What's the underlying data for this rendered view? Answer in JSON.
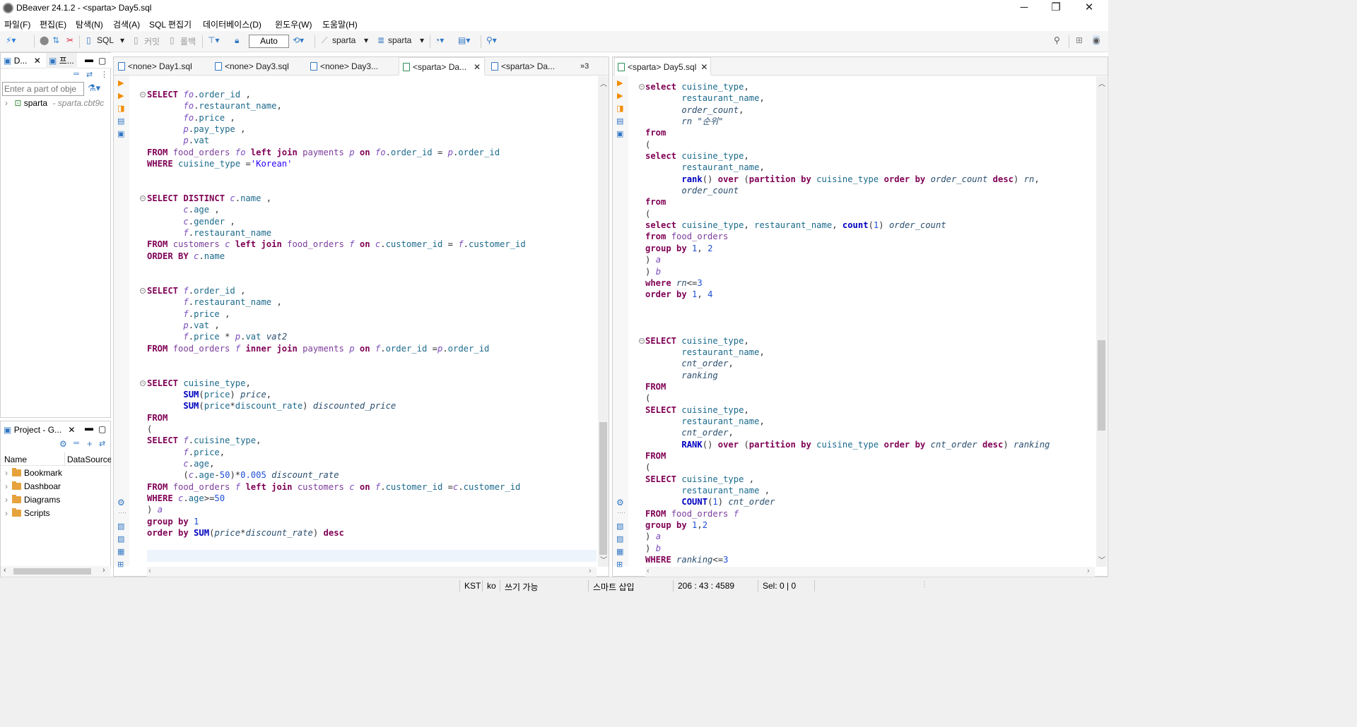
{
  "window": {
    "title": "DBeaver 24.1.2 - <sparta> Day5.sql",
    "controls": {
      "minimize": "─",
      "maximize": "❐",
      "close": "✕"
    }
  },
  "menu": [
    "파일(F)",
    "편집(E)",
    "탐색(N)",
    "검색(A)",
    "SQL 편집기",
    "데이터베이스(D)",
    "윈도우(W)",
    "도움말(H)"
  ],
  "toolbar": {
    "sql_label": "SQL",
    "commit_label": "커밋",
    "rollback_label": "롤백",
    "transaction_mode": "Auto",
    "datasource": "sparta",
    "schema": "sparta"
  },
  "navigator": {
    "tab1": "D...",
    "tab2": "프...",
    "filter_placeholder": "Enter a part of obje",
    "tree": [
      {
        "label": "sparta",
        "detail": "- sparta.cbt9c"
      }
    ]
  },
  "project": {
    "tab": "Project - G...",
    "col_name": "Name",
    "col_datasource": "DataSource",
    "items": [
      "Bookmark",
      "Dashboar",
      "Diagrams",
      "Scripts"
    ]
  },
  "editor_left": {
    "tabs": [
      "<none> Day1.sql",
      "<none> Day3.sql",
      "<none> Day3...",
      "<sparta> Da...",
      "<sparta> Da..."
    ],
    "overflow": "»3"
  },
  "editor_right": {
    "tab": "<sparta> Day5.sql"
  },
  "status": {
    "timezone": "KST",
    "locale": "ko",
    "writable": "쓰기 가능",
    "insert_mode": "스마트 삽입",
    "position": "206 : 43 : 4589",
    "selection": "Sel: 0 | 0"
  },
  "colors": {
    "keyword": "#7f0055",
    "function": "#0000c0",
    "alias": "#7c4dbe",
    "table": "#7c3c9c",
    "column": "#1c6a8c",
    "string": "#2a00ff",
    "number": "#1d4fd6",
    "accent": "#3277c4"
  },
  "icons": [
    "dbeaver-app-icon",
    "new-connection-icon",
    "connect-icon",
    "disconnect-icon",
    "sql-editor-icon",
    "commit-icon",
    "rollback-icon",
    "transaction-icon",
    "lock-icon",
    "history-icon",
    "datasource-icon",
    "schema-icon",
    "search-icon",
    "filter-icon",
    "run-icon",
    "script-icon",
    "settings-icon"
  ],
  "code_left": [
    [
      [
        "kw",
        "SELECT "
      ],
      [
        "al",
        "fo"
      ],
      [
        "",
        "."
      ],
      [
        "col",
        "order_id"
      ],
      [
        "",
        " ,"
      ]
    ],
    [
      [
        "",
        "       "
      ],
      [
        "al",
        "fo"
      ],
      [
        "",
        "."
      ],
      [
        "col",
        "restaurant_name"
      ],
      [
        "",
        ","
      ]
    ],
    [
      [
        "",
        "       "
      ],
      [
        "al",
        "fo"
      ],
      [
        "",
        "."
      ],
      [
        "col",
        "price"
      ],
      [
        "",
        " ,"
      ]
    ],
    [
      [
        "",
        "       "
      ],
      [
        "al",
        "p"
      ],
      [
        "",
        "."
      ],
      [
        "col",
        "pay_type"
      ],
      [
        "",
        " ,"
      ]
    ],
    [
      [
        "",
        "       "
      ],
      [
        "al",
        "p"
      ],
      [
        "",
        "."
      ],
      [
        "col",
        "vat"
      ]
    ],
    [
      [
        "kw",
        "FROM "
      ],
      [
        "tbl",
        "food_orders "
      ],
      [
        "al",
        "fo "
      ],
      [
        "kw",
        "left join "
      ],
      [
        "tbl",
        "payments "
      ],
      [
        "al",
        "p "
      ],
      [
        "kw",
        "on "
      ],
      [
        "al",
        "fo"
      ],
      [
        "",
        "."
      ],
      [
        "col",
        "order_id"
      ],
      [
        "",
        " = "
      ],
      [
        "al",
        "p"
      ],
      [
        "",
        "."
      ],
      [
        "col",
        "order_id"
      ]
    ],
    [
      [
        "kw",
        "WHERE "
      ],
      [
        "col",
        "cuisine_type "
      ],
      [
        "",
        "="
      ],
      [
        "str",
        "'Korean'"
      ]
    ],
    [],
    [],
    [
      [
        "kw",
        "SELECT DISTINCT "
      ],
      [
        "al",
        "c"
      ],
      [
        "",
        "."
      ],
      [
        "col",
        "name"
      ],
      [
        "",
        " ,"
      ]
    ],
    [
      [
        "",
        "       "
      ],
      [
        "al",
        "c"
      ],
      [
        "",
        "."
      ],
      [
        "col",
        "age"
      ],
      [
        "",
        " ,"
      ]
    ],
    [
      [
        "",
        "       "
      ],
      [
        "al",
        "c"
      ],
      [
        "",
        "."
      ],
      [
        "col",
        "gender"
      ],
      [
        "",
        " ,"
      ]
    ],
    [
      [
        "",
        "       "
      ],
      [
        "al",
        "f"
      ],
      [
        "",
        "."
      ],
      [
        "col",
        "restaurant_name"
      ]
    ],
    [
      [
        "kw",
        "FROM "
      ],
      [
        "tbl",
        "customers "
      ],
      [
        "al",
        "c "
      ],
      [
        "kw",
        "left join "
      ],
      [
        "tbl",
        "food_orders "
      ],
      [
        "al",
        "f "
      ],
      [
        "kw",
        "on "
      ],
      [
        "al",
        "c"
      ],
      [
        "",
        "."
      ],
      [
        "col",
        "customer_id"
      ],
      [
        "",
        " = "
      ],
      [
        "al",
        "f"
      ],
      [
        "",
        "."
      ],
      [
        "col",
        "customer_id"
      ]
    ],
    [
      [
        "kw",
        "ORDER BY "
      ],
      [
        "al",
        "c"
      ],
      [
        "",
        "."
      ],
      [
        "col",
        "name"
      ]
    ],
    [],
    [],
    [
      [
        "kw",
        "SELECT "
      ],
      [
        "al",
        "f"
      ],
      [
        "",
        "."
      ],
      [
        "col",
        "order_id"
      ],
      [
        "",
        " ,"
      ]
    ],
    [
      [
        "",
        "       "
      ],
      [
        "al",
        "f"
      ],
      [
        "",
        "."
      ],
      [
        "col",
        "restaurant_name"
      ],
      [
        "",
        " ,"
      ]
    ],
    [
      [
        "",
        "       "
      ],
      [
        "al",
        "f"
      ],
      [
        "",
        "."
      ],
      [
        "col",
        "price"
      ],
      [
        "",
        " ,"
      ]
    ],
    [
      [
        "",
        "       "
      ],
      [
        "al",
        "p"
      ],
      [
        "",
        "."
      ],
      [
        "col",
        "vat"
      ],
      [
        "",
        " ,"
      ]
    ],
    [
      [
        "",
        "       "
      ],
      [
        "al",
        "f"
      ],
      [
        "",
        "."
      ],
      [
        "col",
        "price"
      ],
      [
        "",
        " * "
      ],
      [
        "al",
        "p"
      ],
      [
        "",
        "."
      ],
      [
        "col",
        "vat "
      ],
      [
        "ita",
        "vat2"
      ]
    ],
    [
      [
        "kw",
        "FROM "
      ],
      [
        "tbl",
        "food_orders "
      ],
      [
        "al",
        "f "
      ],
      [
        "kw",
        "inner join "
      ],
      [
        "tbl",
        "payments "
      ],
      [
        "al",
        "p "
      ],
      [
        "kw",
        "on "
      ],
      [
        "al",
        "f"
      ],
      [
        "",
        "."
      ],
      [
        "col",
        "order_id"
      ],
      [
        "",
        " ="
      ],
      [
        "al",
        "p"
      ],
      [
        "",
        "."
      ],
      [
        "col",
        "order_id"
      ]
    ],
    [],
    [],
    [
      [
        "kw",
        "SELECT "
      ],
      [
        "col",
        "cuisine_type"
      ],
      [
        "",
        ","
      ]
    ],
    [
      [
        "",
        "       "
      ],
      [
        "kw2",
        "SUM"
      ],
      [
        "",
        "("
      ],
      [
        "col",
        "price"
      ],
      [
        "",
        ") "
      ],
      [
        "ita",
        "price"
      ],
      [
        "",
        ","
      ]
    ],
    [
      [
        "",
        "       "
      ],
      [
        "kw2",
        "SUM"
      ],
      [
        "",
        "("
      ],
      [
        "col",
        "price"
      ],
      [
        "",
        "*"
      ],
      [
        "col",
        "discount_rate"
      ],
      [
        "",
        ") "
      ],
      [
        "ita",
        "discounted_price"
      ]
    ],
    [
      [
        "kw",
        "FROM"
      ]
    ],
    [
      [
        "",
        "("
      ]
    ],
    [
      [
        "kw",
        "SELECT "
      ],
      [
        "al",
        "f"
      ],
      [
        "",
        "."
      ],
      [
        "col",
        "cuisine_type"
      ],
      [
        "",
        ","
      ]
    ],
    [
      [
        "",
        "       "
      ],
      [
        "al",
        "f"
      ],
      [
        "",
        "."
      ],
      [
        "col",
        "price"
      ],
      [
        "",
        ","
      ]
    ],
    [
      [
        "",
        "       "
      ],
      [
        "al",
        "c"
      ],
      [
        "",
        "."
      ],
      [
        "col",
        "age"
      ],
      [
        "",
        ","
      ]
    ],
    [
      [
        "",
        "       ("
      ],
      [
        "al",
        "c"
      ],
      [
        "",
        "."
      ],
      [
        "col",
        "age"
      ],
      [
        "",
        "-"
      ],
      [
        "num",
        "50"
      ],
      [
        "",
        ")*"
      ],
      [
        "num",
        "0.005 "
      ],
      [
        "ita",
        "discount_rate"
      ]
    ],
    [
      [
        "kw",
        "FROM "
      ],
      [
        "tbl",
        "food_orders "
      ],
      [
        "al",
        "f "
      ],
      [
        "kw",
        "left join "
      ],
      [
        "tbl",
        "customers "
      ],
      [
        "al",
        "c "
      ],
      [
        "kw",
        "on "
      ],
      [
        "al",
        "f"
      ],
      [
        "",
        "."
      ],
      [
        "col",
        "customer_id"
      ],
      [
        "",
        " ="
      ],
      [
        "al",
        "c"
      ],
      [
        "",
        "."
      ],
      [
        "col",
        "customer_id"
      ]
    ],
    [
      [
        "kw",
        "WHERE "
      ],
      [
        "al",
        "c"
      ],
      [
        "",
        "."
      ],
      [
        "col",
        "age"
      ],
      [
        "",
        ">="
      ],
      [
        "num",
        "50"
      ]
    ],
    [
      [
        "",
        ") "
      ],
      [
        "al",
        "a"
      ]
    ],
    [
      [
        "kw",
        "group by "
      ],
      [
        "num",
        "1"
      ]
    ],
    [
      [
        "kw",
        "order by "
      ],
      [
        "kw2",
        "SUM"
      ],
      [
        "",
        "("
      ],
      [
        "ita",
        "price"
      ],
      [
        "",
        "*"
      ],
      [
        "ita",
        "discount_rate"
      ],
      [
        "",
        ") "
      ],
      [
        "kw",
        "desc"
      ]
    ]
  ],
  "code_right": [
    [
      [
        "kw",
        "select "
      ],
      [
        "col",
        "cuisine_type"
      ],
      [
        "",
        ","
      ]
    ],
    [
      [
        "",
        "       "
      ],
      [
        "col",
        "restaurant_name"
      ],
      [
        "",
        ","
      ]
    ],
    [
      [
        "",
        "       "
      ],
      [
        "ita",
        "order_count"
      ],
      [
        "",
        ","
      ]
    ],
    [
      [
        "",
        "       "
      ],
      [
        "ita",
        "rn "
      ],
      [
        "ita",
        "\"순위\""
      ]
    ],
    [
      [
        "kw",
        "from"
      ]
    ],
    [
      [
        "",
        "("
      ]
    ],
    [
      [
        "kw",
        "select "
      ],
      [
        "col",
        "cuisine_type"
      ],
      [
        "",
        ","
      ]
    ],
    [
      [
        "",
        "       "
      ],
      [
        "col",
        "restaurant_name"
      ],
      [
        "",
        ","
      ]
    ],
    [
      [
        "",
        "       "
      ],
      [
        "kw2",
        "rank"
      ],
      [
        "",
        "() "
      ],
      [
        "kw",
        "over "
      ],
      [
        "",
        "("
      ],
      [
        "kw",
        "partition by "
      ],
      [
        "col",
        "cuisine_type "
      ],
      [
        "kw",
        "order by "
      ],
      [
        "ita",
        "order_count "
      ],
      [
        "kw",
        "desc"
      ],
      [
        "",
        ") "
      ],
      [
        "ita",
        "rn"
      ],
      [
        "",
        ","
      ]
    ],
    [
      [
        "",
        "       "
      ],
      [
        "ita",
        "order_count"
      ]
    ],
    [
      [
        "kw",
        "from"
      ]
    ],
    [
      [
        "",
        "("
      ]
    ],
    [
      [
        "kw",
        "select "
      ],
      [
        "col",
        "cuisine_type"
      ],
      [
        "",
        ", "
      ],
      [
        "col",
        "restaurant_name"
      ],
      [
        "",
        ", "
      ],
      [
        "kw2",
        "count"
      ],
      [
        "",
        "("
      ],
      [
        "num",
        "1"
      ],
      [
        "",
        ") "
      ],
      [
        "ita",
        "order_count"
      ]
    ],
    [
      [
        "kw",
        "from "
      ],
      [
        "tbl",
        "food_orders"
      ]
    ],
    [
      [
        "kw",
        "group by "
      ],
      [
        "num",
        "1"
      ],
      [
        "",
        ", "
      ],
      [
        "num",
        "2"
      ]
    ],
    [
      [
        "",
        ") "
      ],
      [
        "al",
        "a"
      ]
    ],
    [
      [
        "",
        ") "
      ],
      [
        "al",
        "b"
      ]
    ],
    [
      [
        "kw",
        "where "
      ],
      [
        "ita",
        "rn"
      ],
      [
        "",
        "<="
      ],
      [
        "num",
        "3"
      ]
    ],
    [
      [
        "kw",
        "order by "
      ],
      [
        "num",
        "1"
      ],
      [
        "",
        ", "
      ],
      [
        "num",
        "4"
      ]
    ],
    [],
    [],
    [],
    [
      [
        "kw",
        "SELECT "
      ],
      [
        "col",
        "cuisine_type"
      ],
      [
        "",
        ","
      ]
    ],
    [
      [
        "",
        "       "
      ],
      [
        "col",
        "restaurant_name"
      ],
      [
        "",
        ","
      ]
    ],
    [
      [
        "",
        "       "
      ],
      [
        "ita",
        "cnt_order"
      ],
      [
        "",
        ","
      ]
    ],
    [
      [
        "",
        "       "
      ],
      [
        "ita",
        "ranking"
      ]
    ],
    [
      [
        "kw",
        "FROM"
      ]
    ],
    [
      [
        "",
        "("
      ]
    ],
    [
      [
        "kw",
        "SELECT "
      ],
      [
        "col",
        "cuisine_type"
      ],
      [
        "",
        ","
      ]
    ],
    [
      [
        "",
        "       "
      ],
      [
        "col",
        "restaurant_name"
      ],
      [
        "",
        ","
      ]
    ],
    [
      [
        "",
        "       "
      ],
      [
        "ita",
        "cnt_order"
      ],
      [
        "",
        ","
      ]
    ],
    [
      [
        "",
        "       "
      ],
      [
        "kw2",
        "RANK"
      ],
      [
        "",
        "() "
      ],
      [
        "kw",
        "over "
      ],
      [
        "",
        "("
      ],
      [
        "kw",
        "partition by "
      ],
      [
        "col",
        "cuisine_type "
      ],
      [
        "kw",
        "order by "
      ],
      [
        "ita",
        "cnt_order "
      ],
      [
        "kw",
        "desc"
      ],
      [
        "",
        ") "
      ],
      [
        "ita",
        "ranking"
      ]
    ],
    [
      [
        "kw",
        "FROM"
      ]
    ],
    [
      [
        "",
        "("
      ]
    ],
    [
      [
        "kw",
        "SELECT "
      ],
      [
        "col",
        "cuisine_type "
      ],
      [
        "",
        ","
      ]
    ],
    [
      [
        "",
        "       "
      ],
      [
        "col",
        "restaurant_name "
      ],
      [
        "",
        ","
      ]
    ],
    [
      [
        "",
        "       "
      ],
      [
        "kw2",
        "COUNT"
      ],
      [
        "",
        "("
      ],
      [
        "num",
        "1"
      ],
      [
        "",
        ") "
      ],
      [
        "ita",
        "cnt_order"
      ]
    ],
    [
      [
        "kw",
        "FROM "
      ],
      [
        "tbl",
        "food_orders "
      ],
      [
        "al",
        "f"
      ]
    ],
    [
      [
        "kw",
        "group by "
      ],
      [
        "num",
        "1"
      ],
      [
        "",
        ","
      ],
      [
        "num",
        "2"
      ]
    ],
    [
      [
        "",
        ") "
      ],
      [
        "al",
        "a"
      ]
    ],
    [
      [
        "",
        ") "
      ],
      [
        "al",
        "b"
      ]
    ],
    [
      [
        "kw",
        "WHERE "
      ],
      [
        "ita",
        "ranking"
      ],
      [
        "",
        "<="
      ],
      [
        "num",
        "3"
      ]
    ]
  ]
}
